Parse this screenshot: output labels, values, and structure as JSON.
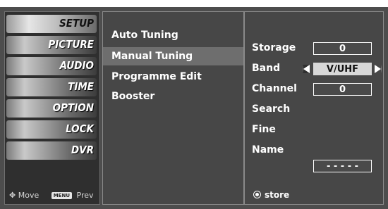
{
  "left_menu": {
    "items": [
      {
        "label": "SETUP",
        "selected": true
      },
      {
        "label": "PICTURE",
        "selected": false
      },
      {
        "label": "AUDIO",
        "selected": false
      },
      {
        "label": "TIME",
        "selected": false
      },
      {
        "label": "OPTION",
        "selected": false
      },
      {
        "label": "LOCK",
        "selected": false
      },
      {
        "label": "DVR",
        "selected": false
      }
    ],
    "hint_move": "Move",
    "hint_menu_key": "MENU",
    "hint_prev": "Prev"
  },
  "middle_menu": {
    "items": [
      {
        "label": "Auto Tuning",
        "selected": false
      },
      {
        "label": "Manual Tuning",
        "selected": true
      },
      {
        "label": "Programme Edit",
        "selected": false
      },
      {
        "label": "Booster",
        "selected": false
      }
    ]
  },
  "right_panel": {
    "storage_label": "Storage",
    "storage_value": "0",
    "band_label": "Band",
    "band_value": "V/UHF",
    "channel_label": "Channel",
    "channel_value": "0",
    "search_label": "Search",
    "fine_label": "Fine",
    "name_label": "Name",
    "name_value": "- - - - -",
    "store_label": "store"
  },
  "icons": {
    "move": "four-way-arrow-icon",
    "menu": "menu-key-icon",
    "store": "radio-dot-icon",
    "band_left": "triangle-left-icon",
    "band_right": "triangle-right-icon"
  },
  "colors": {
    "background": "#4d4d4d",
    "panel": "#474747",
    "highlight": "#6e6e6e",
    "text": "#ffffff"
  }
}
